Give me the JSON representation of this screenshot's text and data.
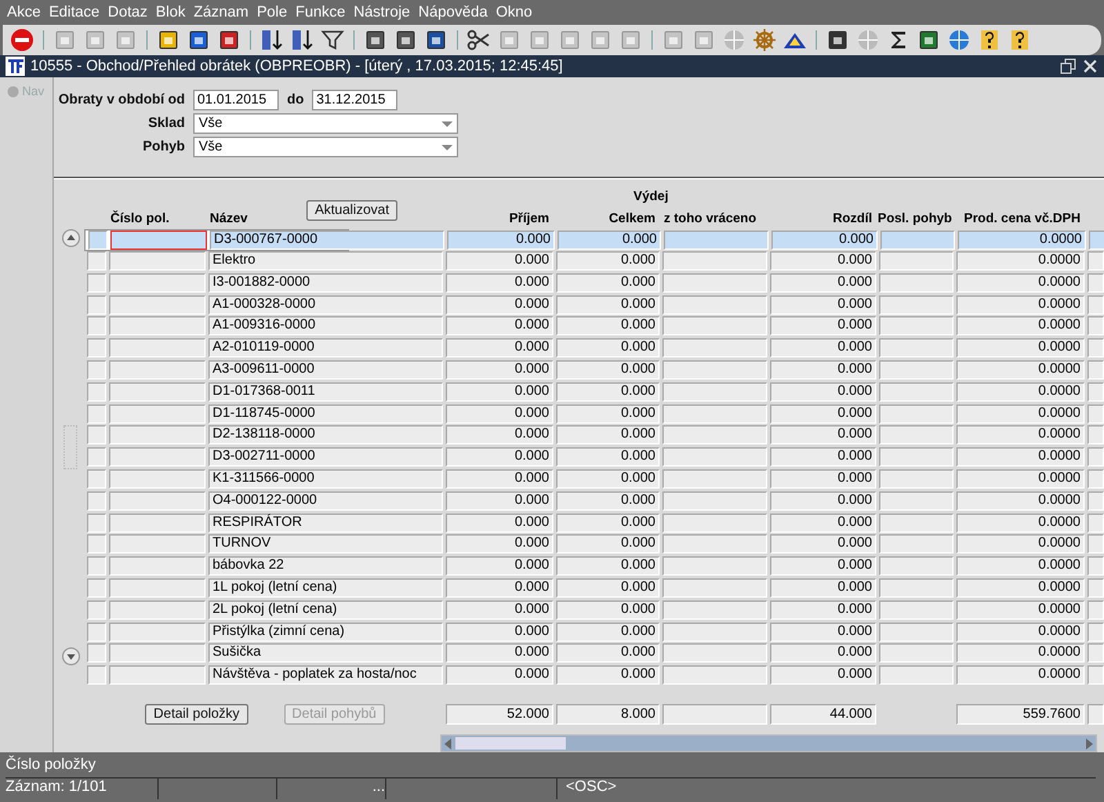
{
  "menu": [
    "Akce",
    "Editace",
    "Dotaz",
    "Blok",
    "Záznam",
    "Pole",
    "Funkce",
    "Nástroje",
    "Nápověda",
    "Okno"
  ],
  "window": {
    "title": "10555 - Obchod/Přehled obrátek (OBPREOBR) - [úterý  , 17.03.2015; 12:45:45]"
  },
  "nav": {
    "label": "Nav"
  },
  "form": {
    "period_label": "Obraty v období od",
    "from": "01.01.2015",
    "to_label": "do",
    "to": "31.12.2015",
    "sklad_label": "Sklad",
    "sklad": "Vše",
    "pohyb_label": "Pohyb",
    "pohyb": "Vše"
  },
  "refresh_button": "Aktualizovat",
  "table": {
    "group_header": "Výdej",
    "columns": [
      "Číslo pol.",
      "Název",
      "Příjem",
      "Celkem",
      "z toho vráceno",
      "Rozdíl",
      "Posl. pohyb",
      "Prod. cena vč.DPH"
    ],
    "rows": [
      {
        "name": "D3-000767-0000",
        "prijem": "0.000",
        "celkem": "0.000",
        "rozdil": "0.000",
        "cena": "0.0000",
        "selected": true
      },
      {
        "name": "Elektro",
        "prijem": "0.000",
        "celkem": "0.000",
        "rozdil": "0.000",
        "cena": "0.0000",
        "selected": false
      },
      {
        "name": "I3-001882-0000",
        "prijem": "0.000",
        "celkem": "0.000",
        "rozdil": "0.000",
        "cena": "0.0000",
        "selected": false
      },
      {
        "name": "A1-000328-0000",
        "prijem": "0.000",
        "celkem": "0.000",
        "rozdil": "0.000",
        "cena": "0.0000",
        "selected": false
      },
      {
        "name": "A1-009316-0000",
        "prijem": "0.000",
        "celkem": "0.000",
        "rozdil": "0.000",
        "cena": "0.0000",
        "selected": false
      },
      {
        "name": "A2-010119-0000",
        "prijem": "0.000",
        "celkem": "0.000",
        "rozdil": "0.000",
        "cena": "0.0000",
        "selected": false
      },
      {
        "name": "A3-009611-0000",
        "prijem": "0.000",
        "celkem": "0.000",
        "rozdil": "0.000",
        "cena": "0.0000",
        "selected": false
      },
      {
        "name": "D1-017368-0011",
        "prijem": "0.000",
        "celkem": "0.000",
        "rozdil": "0.000",
        "cena": "0.0000",
        "selected": false
      },
      {
        "name": "D1-118745-0000",
        "prijem": "0.000",
        "celkem": "0.000",
        "rozdil": "0.000",
        "cena": "0.0000",
        "selected": false
      },
      {
        "name": "D2-138118-0000",
        "prijem": "0.000",
        "celkem": "0.000",
        "rozdil": "0.000",
        "cena": "0.0000",
        "selected": false
      },
      {
        "name": "D3-002711-0000",
        "prijem": "0.000",
        "celkem": "0.000",
        "rozdil": "0.000",
        "cena": "0.0000",
        "selected": false
      },
      {
        "name": "K1-311566-0000",
        "prijem": "0.000",
        "celkem": "0.000",
        "rozdil": "0.000",
        "cena": "0.0000",
        "selected": false
      },
      {
        "name": "O4-000122-0000",
        "prijem": "0.000",
        "celkem": "0.000",
        "rozdil": "0.000",
        "cena": "0.0000",
        "selected": false
      },
      {
        "name": "RESPIRÁTOR",
        "prijem": "0.000",
        "celkem": "0.000",
        "rozdil": "0.000",
        "cena": "0.0000",
        "selected": false
      },
      {
        "name": "TURNOV",
        "prijem": "0.000",
        "celkem": "0.000",
        "rozdil": "0.000",
        "cena": "0.0000",
        "selected": false
      },
      {
        "name": "bábovka 22",
        "prijem": "0.000",
        "celkem": "0.000",
        "rozdil": "0.000",
        "cena": "0.0000",
        "selected": false
      },
      {
        "name": "1L pokoj (letní cena)",
        "prijem": "0.000",
        "celkem": "0.000",
        "rozdil": "0.000",
        "cena": "0.0000",
        "selected": false
      },
      {
        "name": "2L pokoj (letní cena)",
        "prijem": "0.000",
        "celkem": "0.000",
        "rozdil": "0.000",
        "cena": "0.0000",
        "selected": false
      },
      {
        "name": "Přistýlka (zimní cena)",
        "prijem": "0.000",
        "celkem": "0.000",
        "rozdil": "0.000",
        "cena": "0.0000",
        "selected": false
      },
      {
        "name": "Sušička",
        "prijem": "0.000",
        "celkem": "0.000",
        "rozdil": "0.000",
        "cena": "0.0000",
        "selected": false
      },
      {
        "name": "Návštěva - poplatek za hosta/noc",
        "prijem": "0.000",
        "celkem": "0.000",
        "rozdil": "0.000",
        "cena": "0.0000",
        "selected": false
      }
    ],
    "totals": {
      "prijem": "52.000",
      "celkem": "8.000",
      "rozdil": "44.000",
      "cena": "559.7600"
    }
  },
  "buttons": [
    {
      "label": "Detail položky",
      "disabled": false
    },
    {
      "label": "Detail pohybů",
      "disabled": true
    }
  ],
  "status": {
    "hint": "Číslo položky",
    "record": "Záznam: 1/101",
    "segment": "...",
    "mode": "<OSC>"
  }
}
